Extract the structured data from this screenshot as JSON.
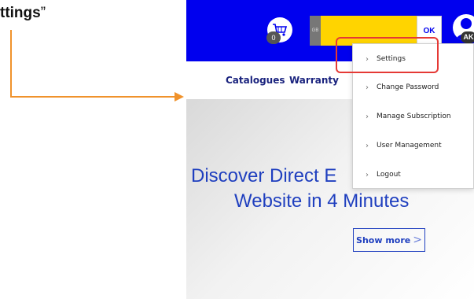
{
  "annotation": {
    "caption_text": "ttings",
    "caption_quote": "”"
  },
  "header": {
    "cart_count": "0",
    "cart_icon": "shopping-cart-icon",
    "search_prefix": "GB",
    "ok_label": "OK",
    "avatar_icon": "user-icon",
    "avatar_initials": "AK"
  },
  "nav": {
    "items": [
      {
        "label": "Catalogues"
      },
      {
        "label": "Warranty"
      }
    ]
  },
  "dropdown": {
    "items": [
      {
        "label": "Settings"
      },
      {
        "label": "Change Password"
      },
      {
        "label": "Manage Subscription"
      },
      {
        "label": "User Management"
      },
      {
        "label": "Logout"
      }
    ]
  },
  "hero": {
    "line1": "Discover Direct E",
    "line2": "Website in 4 Minutes",
    "button_label": "Show more",
    "button_chevron": ">"
  },
  "colors": {
    "header_bg": "#0000ee",
    "search_bg": "#ffd400",
    "highlight": "#e53935",
    "arrow": "#f0922b",
    "hero_text": "#1f3fbf"
  }
}
